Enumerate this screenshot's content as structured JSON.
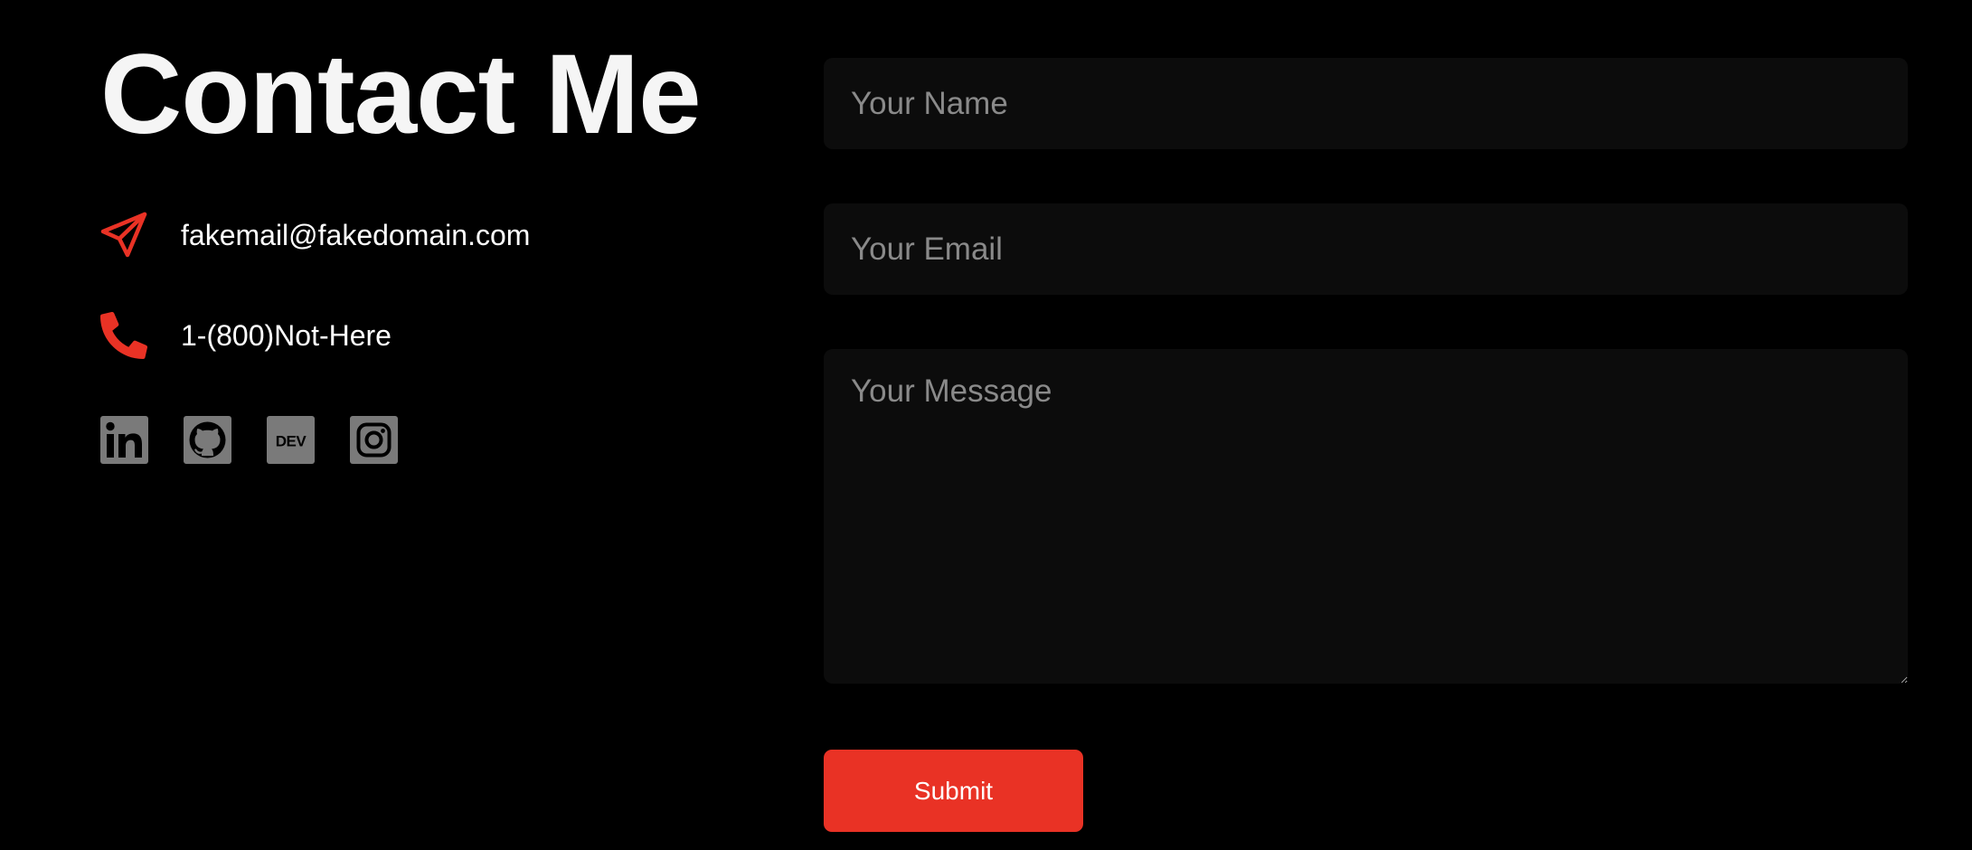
{
  "heading": "Contact Me",
  "contact": {
    "email": {
      "icon": "paper-plane-icon",
      "text": "fakemail@fakedomain.com"
    },
    "phone": {
      "icon": "phone-icon",
      "text": "1-(800)Not-Here"
    }
  },
  "socials": [
    {
      "name": "linkedin-icon",
      "label": "in"
    },
    {
      "name": "github-icon"
    },
    {
      "name": "dev-icon",
      "label": "DEV"
    },
    {
      "name": "instagram-icon"
    }
  ],
  "form": {
    "name_placeholder": "Your Name",
    "email_placeholder": "Your Email",
    "message_placeholder": "Your Message",
    "submit_label": "Submit"
  },
  "colors": {
    "background": "#000000",
    "accent": "#e93225",
    "field_background": "#0c0c0c",
    "social_icon": "#7a7a7a"
  }
}
